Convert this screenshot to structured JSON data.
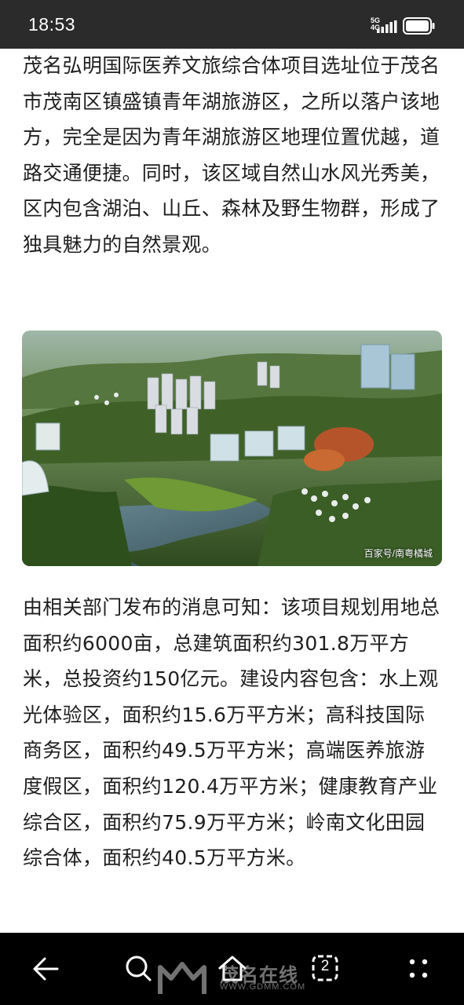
{
  "status_bar": {
    "time": "18:53",
    "network": "5G",
    "network_sub": "4G",
    "battery_icon": "battery-icon",
    "signal_icon": "signal-icon"
  },
  "article": {
    "paragraph_1": "茂名弘明国际医养文旅综合体项目选址位于茂名市茂南区镇盛镇青年湖旅游区，之所以落户该地方，完全是因为青年湖旅游区地理位置优越，道路交通便捷。同时，该区域自然山水风光秀美，区内包含湖泊、山丘、森林及野生物群，形成了独具魅力的自然景观。",
    "image_caption": "百家号/南粤橘城",
    "paragraph_2": "由相关部门发布的消息可知：该项目规划用地总面积约6000亩，总建筑面积约301.8万平方米，总投资约150亿元。建设内容包含：水上观光体验区，面积约15.6万平方米；高科技国际商务区，面积约49.5万平方米；高端医养旅游度假区，面积约120.4万平方米；健康教育产业综合区，面积约75.9万平方米；岭南文化田园综合体，面积约40.5万平方米。"
  },
  "bottom_nav": {
    "back_icon": "back-arrow-icon",
    "search_icon": "search-icon",
    "home_icon": "home-icon",
    "tabs_count": "2",
    "more_icon": "more-dots-icon"
  },
  "watermark": {
    "name": "茂名在线",
    "url": "WWW.GDMM.COM"
  },
  "colors": {
    "status_bar_bg": "#2b2b2b",
    "bottom_bar_bg": "#000000",
    "text": "#1e1e1e"
  }
}
